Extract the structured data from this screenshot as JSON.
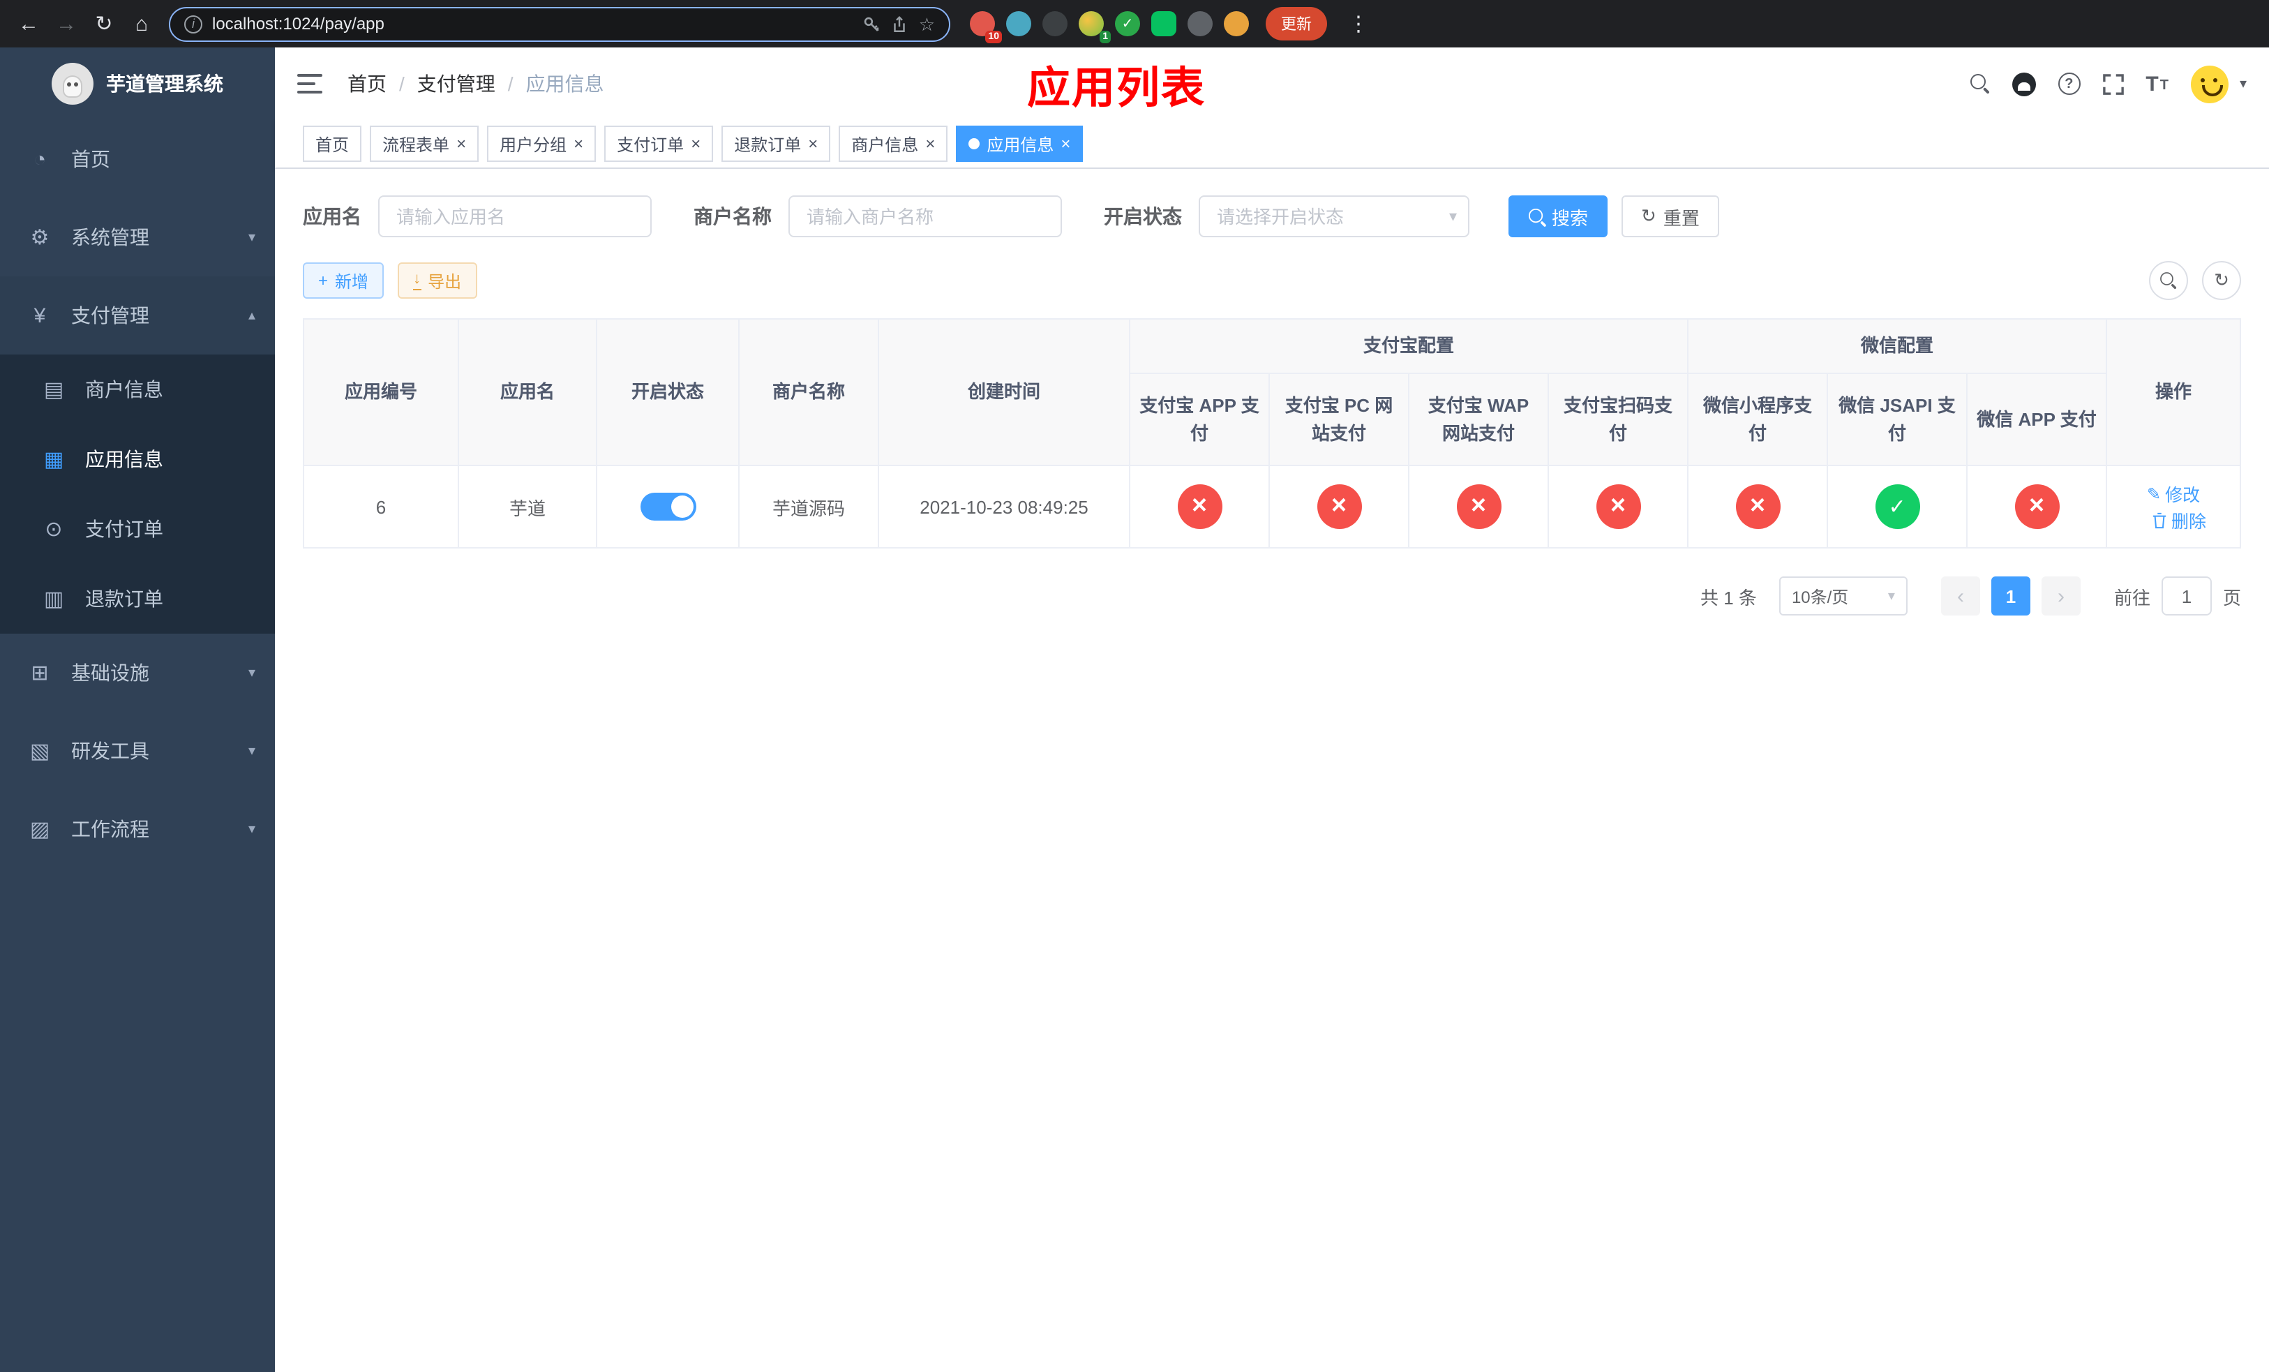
{
  "colors": {
    "primary": "#409eff",
    "danger": "#f5504a",
    "success": "#13ce66",
    "sidebar_bg": "#304156",
    "sidebar_sub_bg": "#1f2d3d",
    "annotation_red": "#ff0000",
    "active_tab_bg": "#409eff"
  },
  "icons": {
    "back": "←",
    "forward": "→",
    "reload": "↻",
    "home": "⌂",
    "info": "i",
    "star": "☆",
    "share": "⇧",
    "menu_dots": "⋮",
    "check": "✓",
    "close": "×",
    "dashboard": "◔",
    "gear": "⚙",
    "yen": "¥",
    "card": "▤",
    "grid": "▦",
    "order": "⊙",
    "refund": "▥",
    "infra": "⊞",
    "tools": "▧",
    "workflow": "▨",
    "chevron_down": "▾",
    "chevron_up": "▴",
    "caret_down": "▾",
    "plus": "+",
    "download": "↓",
    "refresh": "↻",
    "edit": "✎",
    "question": "?",
    "font_size": "T",
    "prev": "‹",
    "next": "›"
  },
  "browser": {
    "url": "localhost:1024/pay/app",
    "update_label": "更新",
    "extension_badges": {
      "first": "10",
      "fourth": "1"
    }
  },
  "sidebar": {
    "app_title": "芋道管理系统",
    "items": [
      {
        "label": "首页"
      },
      {
        "label": "系统管理"
      },
      {
        "label": "支付管理"
      },
      {
        "label": "商户信息"
      },
      {
        "label": "应用信息"
      },
      {
        "label": "支付订单"
      },
      {
        "label": "退款订单"
      },
      {
        "label": "基础设施"
      },
      {
        "label": "研发工具"
      },
      {
        "label": "工作流程"
      }
    ]
  },
  "navbar": {
    "breadcrumb": [
      "首页",
      "支付管理",
      "应用信息"
    ],
    "overlay_title": "应用列表"
  },
  "tabs": [
    {
      "label": "首页"
    },
    {
      "label": "流程表单"
    },
    {
      "label": "用户分组"
    },
    {
      "label": "支付订单"
    },
    {
      "label": "退款订单"
    },
    {
      "label": "商户信息"
    },
    {
      "label": "应用信息"
    }
  ],
  "filters": {
    "app_name": {
      "label": "应用名",
      "placeholder": "请输入应用名",
      "value": ""
    },
    "merchant_name": {
      "label": "商户名称",
      "placeholder": "请输入商户名称",
      "value": ""
    },
    "status": {
      "label": "开启状态",
      "placeholder": "请选择开启状态"
    },
    "search_label": "搜索",
    "reset_label": "重置"
  },
  "toolbar": {
    "add_label": "新增",
    "export_label": "导出"
  },
  "table": {
    "group_headers": {
      "alipay": "支付宝配置",
      "wechat": "微信配置"
    },
    "columns": [
      "应用编号",
      "应用名",
      "开启状态",
      "商户名称",
      "创建时间",
      "支付宝 APP 支付",
      "支付宝 PC 网站支付",
      "支付宝 WAP 网站支付",
      "支付宝扫码支付",
      "微信小程序支付",
      "微信 JSAPI 支付",
      "微信 APP 支付",
      "操作"
    ],
    "rows": [
      {
        "id": "6",
        "name": "芋道",
        "enabled": true,
        "merchant": "芋道源码",
        "created": "2021-10-23 08:49:25",
        "alipay_app": false,
        "alipay_pc": false,
        "alipay_wap": false,
        "alipay_qr": false,
        "wechat_mini": false,
        "wechat_jsapi": true,
        "wechat_app": false,
        "edit_label": "修改",
        "delete_label": "删除"
      }
    ]
  },
  "pagination": {
    "total_text": "共 1 条",
    "page_size": "10条/页",
    "current_page": "1",
    "goto_prefix": "前往",
    "goto_value": "1",
    "goto_suffix": "页"
  }
}
